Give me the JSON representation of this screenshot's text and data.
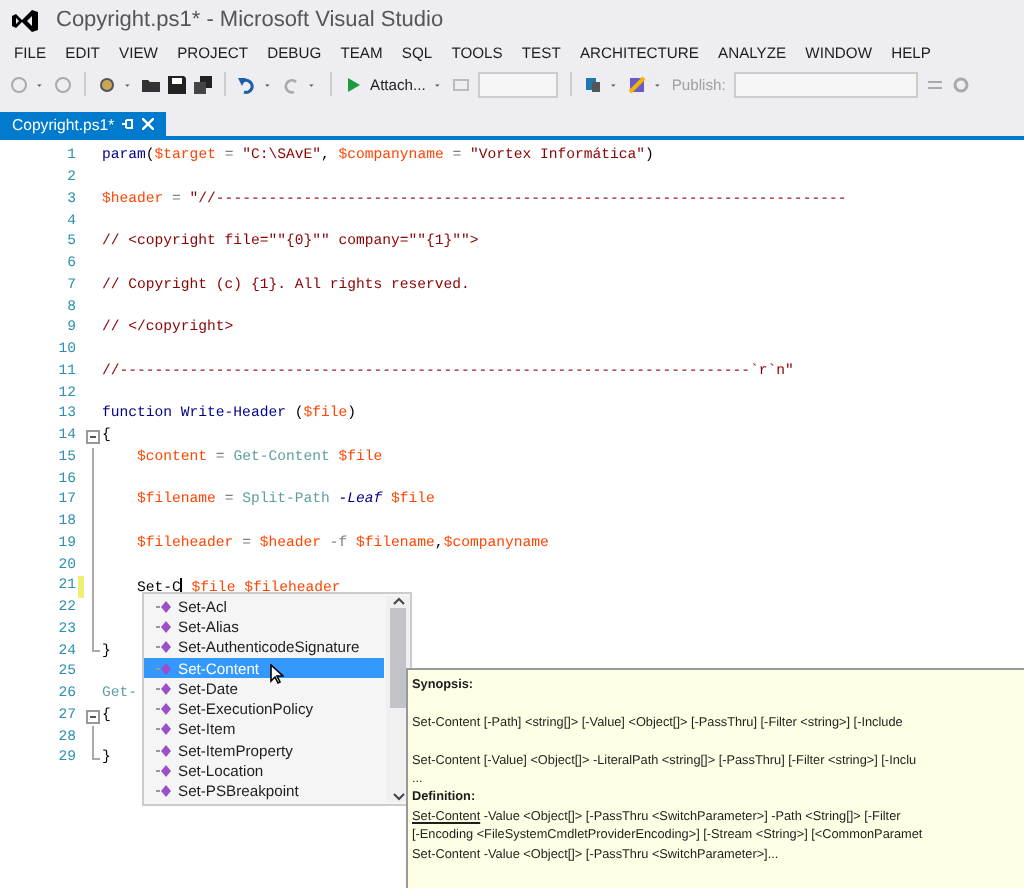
{
  "window": {
    "title": "Copyright.ps1* - Microsoft Visual Studio"
  },
  "menu": [
    "FILE",
    "EDIT",
    "VIEW",
    "PROJECT",
    "DEBUG",
    "TEAM",
    "SQL",
    "TOOLS",
    "TEST",
    "ARCHITECTURE",
    "ANALYZE",
    "WINDOW",
    "HELP"
  ],
  "toolbar": {
    "attach_label": "Attach...",
    "publish_label": "Publish:"
  },
  "tabs": [
    {
      "label": "Copyright.ps1*",
      "selected": true
    }
  ],
  "editor": {
    "lines": [
      {
        "number": "1",
        "kind": "plain",
        "changed": false,
        "tokens": [
          {
            "kind": "keyword",
            "text": "param"
          },
          {
            "kind": "plain",
            "text": "("
          },
          {
            "kind": "variable",
            "text": "$target"
          },
          {
            "kind": "operator",
            "text": " = "
          },
          {
            "kind": "string",
            "text": "\"C:\\SAvE\""
          },
          {
            "kind": "plain",
            "text": ", "
          },
          {
            "kind": "variable",
            "text": "$companyname"
          },
          {
            "kind": "operator",
            "text": " = "
          },
          {
            "kind": "string",
            "text": "\"Vortex Informática\""
          },
          {
            "kind": "plain",
            "text": ")"
          }
        ]
      },
      {
        "number": "2",
        "kind": "plain",
        "changed": false
      },
      {
        "number": "3",
        "kind": "plain",
        "changed": false,
        "tokens": [
          {
            "kind": "variable",
            "text": "$header"
          },
          {
            "kind": "operator",
            "text": " = "
          },
          {
            "kind": "string",
            "text": "\"//------------------------------------------------------------------------"
          }
        ]
      },
      {
        "number": "4",
        "kind": "plain",
        "changed": false
      },
      {
        "number": "5",
        "kind": "plain",
        "changed": false,
        "tokens": [
          {
            "kind": "string",
            "text": "// <copyright file=\"\"{0}\"\" company=\"\"{1}\"\">"
          }
        ]
      },
      {
        "number": "6",
        "kind": "plain",
        "changed": false
      },
      {
        "number": "7",
        "kind": "plain",
        "changed": false,
        "tokens": [
          {
            "kind": "string",
            "text": "// Copyright (c) {1}. All rights reserved."
          }
        ]
      },
      {
        "number": "8",
        "kind": "plain",
        "changed": false
      },
      {
        "number": "9",
        "kind": "plain",
        "changed": false,
        "tokens": [
          {
            "kind": "string",
            "text": "// </copyright>"
          }
        ]
      },
      {
        "number": "10",
        "kind": "plain",
        "changed": false
      },
      {
        "number": "11",
        "kind": "plain",
        "changed": false,
        "tokens": [
          {
            "kind": "string",
            "text": "//------------------------------------------------------------------------`r`n\""
          }
        ]
      },
      {
        "number": "12",
        "kind": "plain",
        "changed": false
      },
      {
        "number": "13",
        "kind": "plain",
        "changed": false,
        "tokens": [
          {
            "kind": "keyword",
            "text": "function"
          },
          {
            "kind": "keyword",
            "text": " Write-Header"
          },
          {
            "kind": "plain",
            "text": " ("
          },
          {
            "kind": "variable",
            "text": "$file"
          },
          {
            "kind": "plain",
            "text": ")"
          }
        ]
      },
      {
        "number": "14",
        "kind": "start",
        "changed": false,
        "tokens": [
          {
            "kind": "plain",
            "text": "{"
          }
        ]
      },
      {
        "number": "15",
        "kind": "body",
        "changed": false,
        "tokens": [
          {
            "kind": "variable",
            "text": "    $content"
          },
          {
            "kind": "operator",
            "text": " = "
          },
          {
            "kind": "command",
            "text": "Get-Content"
          },
          {
            "kind": "variable",
            "text": " $file"
          }
        ]
      },
      {
        "number": "16",
        "kind": "body",
        "changed": false
      },
      {
        "number": "17",
        "kind": "body",
        "changed": false,
        "tokens": [
          {
            "kind": "variable",
            "text": "    $filename"
          },
          {
            "kind": "operator",
            "text": " = "
          },
          {
            "kind": "command",
            "text": "Split-Path"
          },
          {
            "kind": "parameter",
            "text": " -Leaf"
          },
          {
            "kind": "variable",
            "text": " $file"
          }
        ]
      },
      {
        "number": "18",
        "kind": "body",
        "changed": false
      },
      {
        "number": "19",
        "kind": "body",
        "changed": false,
        "tokens": [
          {
            "kind": "variable",
            "text": "    $fileheader"
          },
          {
            "kind": "operator",
            "text": " = "
          },
          {
            "kind": "variable",
            "text": "$header"
          },
          {
            "kind": "operator",
            "text": " -f"
          },
          {
            "kind": "variable",
            "text": " $filename"
          },
          {
            "kind": "plain",
            "text": ","
          },
          {
            "kind": "variable",
            "text": "$companyname"
          }
        ]
      },
      {
        "number": "20",
        "kind": "body",
        "changed": false
      },
      {
        "number": "21",
        "kind": "body",
        "changed": true,
        "tokens": [
          {
            "kind": "plain",
            "text": "    Set-C"
          },
          {
            "kind": "caret"
          },
          {
            "kind": "variable",
            "text": " $file"
          },
          {
            "kind": "variable",
            "text": " $fileheader"
          }
        ]
      },
      {
        "number": "22",
        "kind": "body",
        "changed": false
      },
      {
        "number": "23",
        "kind": "body",
        "changed": false
      },
      {
        "number": "24",
        "kind": "end",
        "changed": false,
        "tokens": [
          {
            "kind": "plain",
            "text": "}"
          }
        ]
      },
      {
        "number": "25",
        "kind": "plain",
        "changed": false
      },
      {
        "number": "26",
        "kind": "plain",
        "changed": false,
        "tokens": [
          {
            "kind": "command",
            "text": "Get-"
          }
        ]
      },
      {
        "number": "27",
        "kind": "start",
        "changed": false,
        "tokens": [
          {
            "kind": "plain",
            "text": "{"
          }
        ]
      },
      {
        "number": "28",
        "kind": "body",
        "changed": false
      },
      {
        "number": "29",
        "kind": "end",
        "changed": false,
        "tokens": [
          {
            "kind": "plain",
            "text": "}"
          }
        ]
      }
    ]
  },
  "completion": {
    "items": [
      {
        "label": "Set-Acl",
        "selected": false
      },
      {
        "label": "Set-Alias",
        "selected": false
      },
      {
        "label": "Set-AuthenticodeSignature",
        "selected": false
      },
      {
        "label": "Set-Content",
        "selected": true
      },
      {
        "label": "Set-Date",
        "selected": false
      },
      {
        "label": "Set-ExecutionPolicy",
        "selected": false
      },
      {
        "label": "Set-Item",
        "selected": false
      },
      {
        "label": "Set-ItemProperty",
        "selected": false
      },
      {
        "label": "Set-Location",
        "selected": false
      },
      {
        "label": "Set-PSBreakpoint",
        "selected": false
      }
    ]
  },
  "tooltip": {
    "synopsis_heading": "Synopsis:",
    "synopsis": [
      "Set-Content [-Path] <string[]> [-Value] <Object[]> [-PassThru] [-Filter <string>] [-Include",
      "Set-Content [-Value] <Object[]> -LiteralPath <string[]> [-PassThru] [-Filter <string>] [-Inclu"
    ],
    "more": "...",
    "definition_heading": "Definition:",
    "definition_name": "Set-Content",
    "definition_rest": " -Value <Object[]> [-PassThru <SwitchParameter>] -Path <String[]> [-Filter",
    "definition_lines": [
      "[-Encoding <FileSystemCmdletProviderEncoding>] [-Stream <String>] [<CommonParamet",
      "Set-Content -Value <Object[]> [-PassThru <SwitchParameter>]..."
    ]
  }
}
